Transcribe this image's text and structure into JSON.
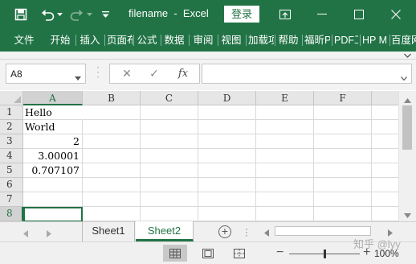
{
  "titlebar": {
    "title": "filename  -  Excel",
    "login_label": "登录",
    "icons": [
      "save-icon",
      "undo-icon",
      "redo-icon",
      "customize-qat-icon",
      "ribbon-display-options-icon",
      "minimize-icon",
      "restore-icon",
      "close-icon"
    ]
  },
  "ribbon": {
    "tabs": [
      "文件",
      "开始",
      "插入",
      "页面布局",
      "公式",
      "数据",
      "审阅",
      "视图",
      "加载项",
      "帮助",
      "福昕PDF",
      "PDF工具集",
      "HP MFP",
      "百度网盘"
    ]
  },
  "formula_bar": {
    "name_box": "A8",
    "cancel_icon": "✕",
    "enter_icon": "✓",
    "fx_label": "fx",
    "formula_value": ""
  },
  "sheet": {
    "columns": [
      "A",
      "B",
      "C",
      "D",
      "E",
      "F"
    ],
    "rows": [
      "1",
      "2",
      "3",
      "4",
      "5",
      "6",
      "7",
      "8"
    ],
    "cells": {
      "A1": "Hello",
      "A2": "World",
      "A3": "2",
      "A4": "3.00001",
      "A5": "0.707107"
    },
    "active_cell": "A8"
  },
  "sheet_tabs": {
    "tabs": [
      "Sheet1",
      "Sheet2"
    ],
    "active": "Sheet2",
    "add_icon": "+"
  },
  "statusbar": {
    "zoom_minus": "−",
    "zoom_plus": "+",
    "zoom_level": "100%",
    "zoom_value": 1.0
  },
  "watermark": "知乎 @lyy",
  "colors": {
    "accent": "#217346",
    "ribbon_bg": "#217346",
    "header_bg": "#e6e6e6",
    "gridline": "#dadada"
  }
}
